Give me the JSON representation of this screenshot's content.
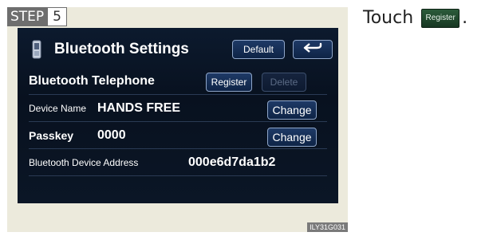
{
  "step": {
    "label": "STEP",
    "number": "5"
  },
  "screen": {
    "title": "Bluetooth Settings",
    "default_button": "Default",
    "section_title": "Bluetooth Telephone",
    "register_button": "Register",
    "delete_button": "Delete",
    "device_name_label": "Device Name",
    "device_name_value": "HANDS FREE",
    "change_button_1": "Change",
    "passkey_label": "Passkey",
    "passkey_value": "0000",
    "change_button_2": "Change",
    "address_label": "Bluetooth Device Address",
    "address_value": "000e6d7da1b2"
  },
  "image_code": "ILY31G031",
  "instruction": {
    "text": "Touch",
    "button_label": "Register",
    "end": "."
  },
  "icons": {
    "back": "back-arrow-icon",
    "phone": "phone-icon"
  },
  "colors": {
    "screen_background": "#0c1a2e",
    "button_fill": "#1e3a66",
    "button_border": "#8fa6c9",
    "instruction_button": "#2b5b3a"
  }
}
